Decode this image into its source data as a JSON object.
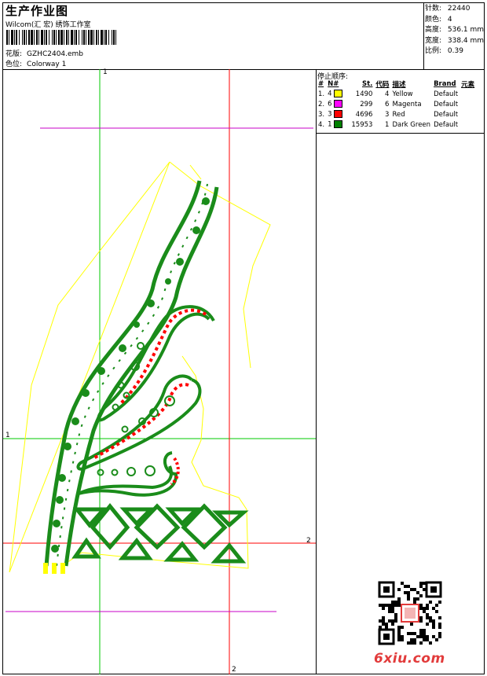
{
  "header": {
    "title": "生产作业图",
    "company": "Wilcom(汇 宏) 绣饰工作室",
    "design_label": "花版:",
    "design_value": "GZHC2404.emb",
    "colorway_label": "色位:",
    "colorway_value": "Colorway 1"
  },
  "stats": [
    {
      "label": "针数:",
      "value": "22440"
    },
    {
      "label": "颜色:",
      "value": "4"
    },
    {
      "label": "高度:",
      "value": "536.1 mm"
    },
    {
      "label": "宽度:",
      "value": "338.4 mm"
    },
    {
      "label": "比例:",
      "value": "0.39"
    }
  ],
  "stop_sequence": {
    "title": "停止顺序:",
    "columns": [
      "#",
      "N#",
      "St.",
      "代码",
      "描述",
      "Brand",
      "元素"
    ],
    "rows": [
      {
        "idx": "1.",
        "n": "4",
        "color": "#ffff00",
        "stitches": "1490",
        "code": "4",
        "desc": "Yellow",
        "brand": "Default"
      },
      {
        "idx": "2.",
        "n": "6",
        "color": "#ff00ff",
        "stitches": "299",
        "code": "6",
        "desc": "Magenta",
        "brand": "Default"
      },
      {
        "idx": "3.",
        "n": "3",
        "color": "#ff0000",
        "stitches": "4696",
        "code": "3",
        "desc": "Red",
        "brand": "Default"
      },
      {
        "idx": "4.",
        "n": "1",
        "color": "#008000",
        "stitches": "15953",
        "code": "1",
        "desc": "Dark Green",
        "brand": "Default"
      }
    ]
  },
  "markers": {
    "v1_top": "1",
    "h1_left": "1",
    "h2_right": "2",
    "v2_bottom": "2"
  },
  "watermark": "6xiu.com",
  "colors": {
    "green": "#1a8c1a",
    "bright_green": "#00c800",
    "red": "#ff0000",
    "magenta": "#c800c8",
    "yellow": "#ffff00"
  }
}
